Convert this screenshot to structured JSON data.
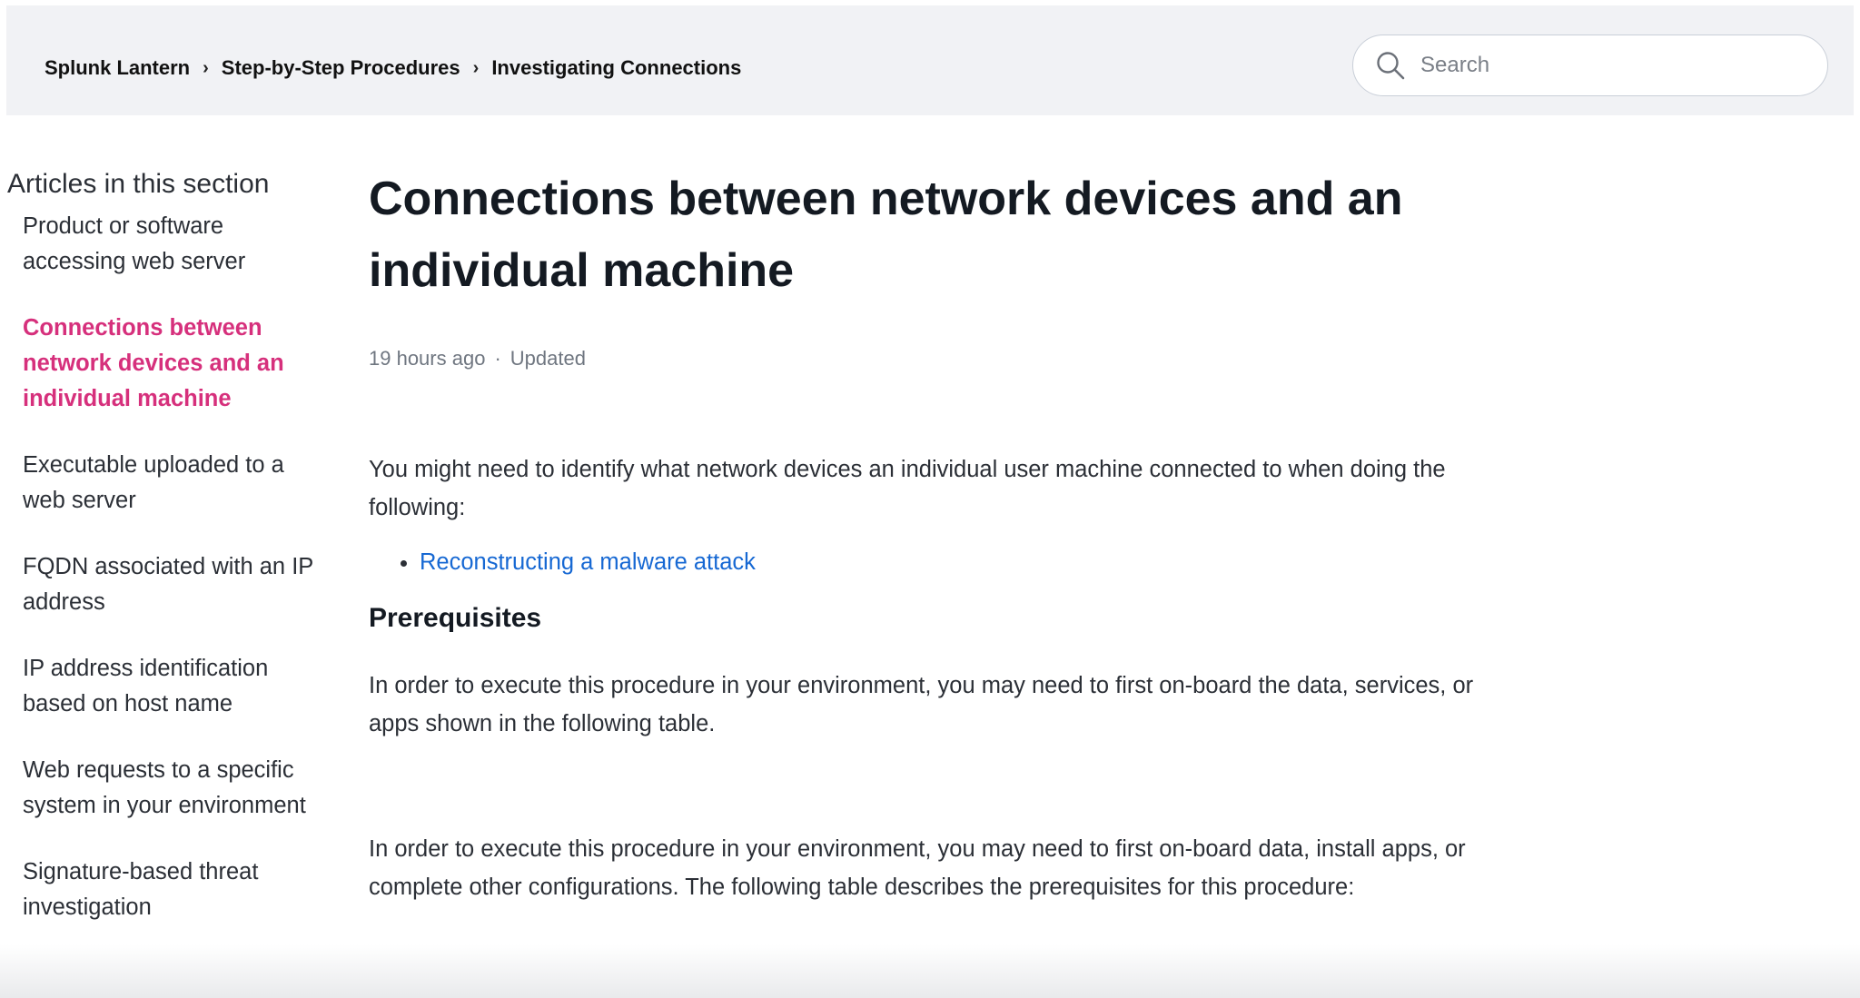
{
  "breadcrumb": {
    "items": [
      "Splunk Lantern",
      "Step-by-Step Procedures",
      "Investigating Connections"
    ],
    "separator": "›"
  },
  "search": {
    "placeholder": "Search",
    "icon": "search-icon"
  },
  "sidebar": {
    "title": "Articles in this section",
    "items": [
      {
        "label": "Product or software accessing web server"
      },
      {
        "label": "Connections between network devices and an individual machine",
        "active": true
      },
      {
        "label": "Executable uploaded to a web server"
      },
      {
        "label": "FQDN associated with an IP address"
      },
      {
        "label": "IP address identification based on host name"
      },
      {
        "label": "Web requests to a specific system in your environment"
      },
      {
        "label": "Signature-based threat investigation"
      }
    ]
  },
  "article": {
    "title": "Connections between network devices and an individual machine",
    "meta": {
      "time": "19 hours ago",
      "dot": "·",
      "status": "Updated"
    },
    "intro": "You might need to identify what network devices an individual user machine connected to when doing the following:",
    "bullets": [
      "Reconstructing a malware attack"
    ],
    "section_heading": "Prerequisites",
    "para2": "In order to execute this procedure in your environment, you may need to first on-board the data, services, or apps shown in the following table.",
    "para3": "In order to execute this procedure in your environment, you may need to first on-board data, install apps, or complete other configurations. The following table describes the prerequisites for this procedure:"
  },
  "colors": {
    "accent_active": "#d6307c",
    "link": "#1668d3",
    "header_bg": "#f1f2f5",
    "text": "#2b2f36"
  }
}
